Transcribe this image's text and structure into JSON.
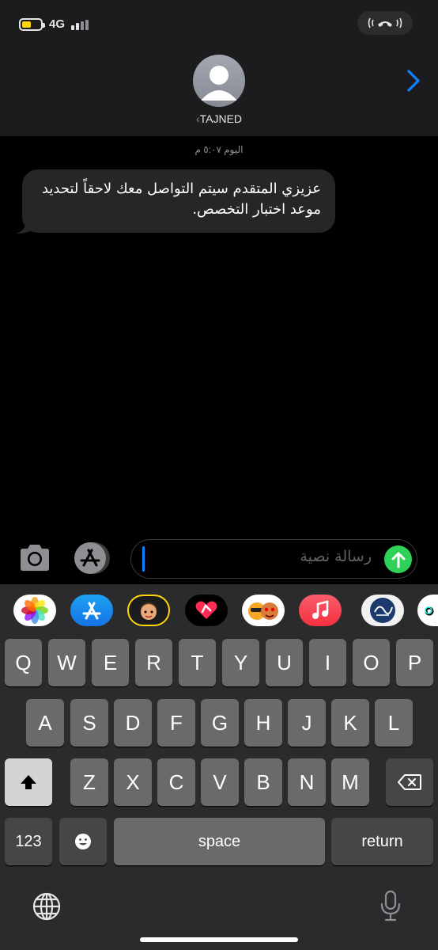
{
  "status_bar": {
    "network": "4G",
    "battery_level": 0.5
  },
  "header": {
    "contact_name": "TAJNED"
  },
  "thread": {
    "timestamp": "اليوم ٥:٠٧ م",
    "messages": [
      {
        "direction": "incoming",
        "text": "عزيزي المتقدم سيتم التواصل معك لاحقاً لتحديد موعد اختبار التخصص."
      }
    ]
  },
  "composer": {
    "placeholder": "رسالة نصية",
    "value": ""
  },
  "app_strip": [
    "photos-icon",
    "app-store-icon",
    "memoji-icon",
    "digital-touch-icon",
    "memoji-stickers-icon",
    "music-icon",
    "sticker-app-icon",
    "tiktok-icon"
  ],
  "keyboard": {
    "row1": [
      "Q",
      "W",
      "E",
      "R",
      "T",
      "Y",
      "U",
      "I",
      "O",
      "P"
    ],
    "row2": [
      "A",
      "S",
      "D",
      "F",
      "G",
      "H",
      "J",
      "K",
      "L"
    ],
    "row3": [
      "Z",
      "X",
      "C",
      "V",
      "B",
      "N",
      "M"
    ],
    "numbers_label": "123",
    "space_label": "space",
    "return_label": "return"
  },
  "colors": {
    "send": "#30d158",
    "accent": "#0a84ff",
    "bubble": "#262628"
  }
}
